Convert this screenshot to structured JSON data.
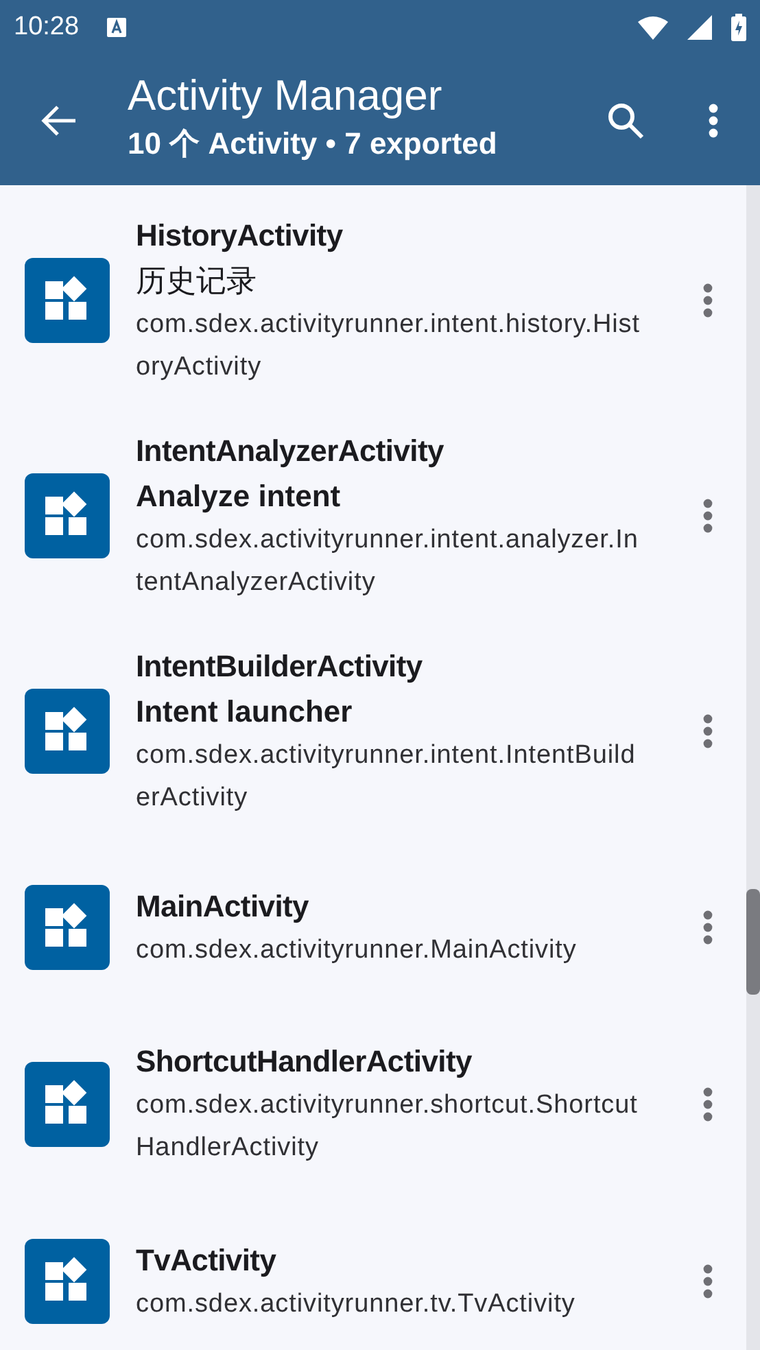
{
  "status_bar": {
    "time": "10:28"
  },
  "app_bar": {
    "title": "Activity Manager",
    "subtitle": "10 个 Activity • 7 exported"
  },
  "activities": [
    {
      "name": "HistoryActivity",
      "label": "历史记录",
      "package": "com.sdex.activityrunner.intent.history.HistoryActivity"
    },
    {
      "name": "IntentAnalyzerActivity",
      "label": "Analyze intent",
      "package": "com.sdex.activityrunner.intent.analyzer.IntentAnalyzerActivity"
    },
    {
      "name": "IntentBuilderActivity",
      "label": "Intent launcher",
      "package": "com.sdex.activityrunner.intent.IntentBuilderActivity"
    },
    {
      "name": "MainActivity",
      "package": "com.sdex.activityrunner.MainActivity"
    },
    {
      "name": "ShortcutHandlerActivity",
      "package": "com.sdex.activityrunner.shortcut.ShortcutHandlerActivity"
    },
    {
      "name": "TvActivity",
      "package": "com.sdex.activityrunner.tv.TvActivity"
    }
  ]
}
